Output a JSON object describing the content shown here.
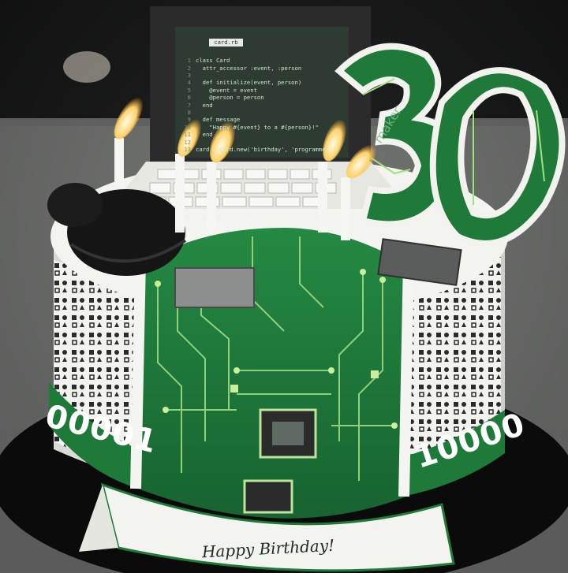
{
  "scene": {
    "subject": "circuit-board-birthday-cake",
    "laptop_code": {
      "tab_label": "card.rb",
      "lines": [
        "class Card",
        "  attr_accessor :event, :person",
        "",
        "  def initialize(event, person)",
        "    @event = event",
        "    @person = person",
        "  end",
        "",
        "  def message",
        "    \"Happy #{event} to a #{person}!\"",
        "  end",
        "",
        "card = Card.new('birthday', 'programmer')"
      ]
    },
    "topper_number": "30",
    "topper_small_text": "maker",
    "binary_left": "00001",
    "binary_right": "10000",
    "banner_text": "Happy Birthday!",
    "colors": {
      "board_green": "#1f7a3a",
      "trace_green": "#8fd17a",
      "fondant_white": "#f1f1ee",
      "fondant_black": "#151515",
      "background": "#1b1d1c"
    },
    "icons": [
      "laptop-keyboard-icon",
      "computer-mouse-icon",
      "cpu-chip-icon",
      "candle-flame-icon"
    ]
  }
}
